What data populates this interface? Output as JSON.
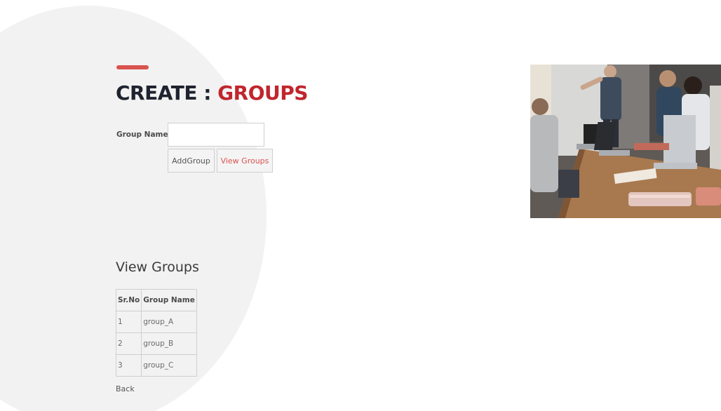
{
  "header": {
    "title_part1": "CREATE : ",
    "title_part2": "GROUPS"
  },
  "form": {
    "group_name_label": "Group Name",
    "group_name_value": "",
    "add_group_label": "AddGroup",
    "view_groups_label": "View Groups"
  },
  "view_section": {
    "heading": "View Groups",
    "columns": [
      "Sr.No",
      "Group Name"
    ],
    "rows": [
      {
        "sr": "1",
        "name": "group_A"
      },
      {
        "sr": "2",
        "name": "group_B"
      },
      {
        "sr": "3",
        "name": "group_C"
      }
    ],
    "back_label": "Back"
  },
  "colors": {
    "accent": "#c0262d",
    "accent_bar": "#d9534f",
    "title_dark": "#1f2330",
    "background_blob": "#f2f2f2"
  },
  "image": {
    "description": "meeting-photo"
  }
}
